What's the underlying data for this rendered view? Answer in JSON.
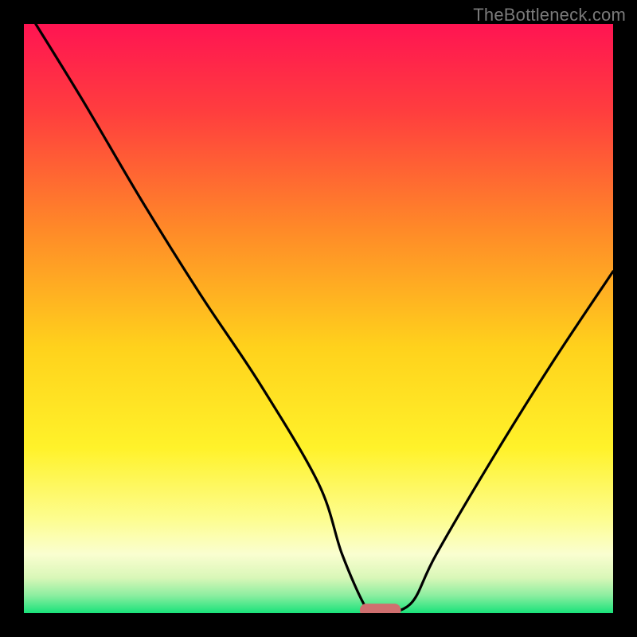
{
  "watermark": "TheBottleneck.com",
  "chart_data": {
    "type": "line",
    "title": "",
    "xlabel": "",
    "ylabel": "",
    "xlim": [
      0,
      100
    ],
    "ylim": [
      0,
      100
    ],
    "grid": false,
    "legend": false,
    "series": [
      {
        "name": "bottleneck-curve",
        "x": [
          2,
          10,
          20,
          30,
          40,
          50,
          54,
          58,
          60,
          62,
          66,
          70,
          80,
          90,
          100
        ],
        "y": [
          100,
          87,
          70,
          54,
          39,
          22,
          10,
          1,
          0,
          0,
          2,
          10,
          27,
          43,
          58
        ]
      }
    ],
    "marker": {
      "name": "optimal-marker",
      "x": 60.5,
      "y": 0.5,
      "width": 7,
      "height": 2.2,
      "color": "#cf6f6f"
    },
    "background_gradient": {
      "stops": [
        {
          "offset": 0.0,
          "color": "#ff1452"
        },
        {
          "offset": 0.15,
          "color": "#ff3e3e"
        },
        {
          "offset": 0.35,
          "color": "#ff8a28"
        },
        {
          "offset": 0.55,
          "color": "#ffd21c"
        },
        {
          "offset": 0.72,
          "color": "#fff22a"
        },
        {
          "offset": 0.84,
          "color": "#fdfd8f"
        },
        {
          "offset": 0.9,
          "color": "#fafed0"
        },
        {
          "offset": 0.94,
          "color": "#d9f7b8"
        },
        {
          "offset": 0.97,
          "color": "#8ceea0"
        },
        {
          "offset": 1.0,
          "color": "#19e27a"
        }
      ]
    }
  }
}
